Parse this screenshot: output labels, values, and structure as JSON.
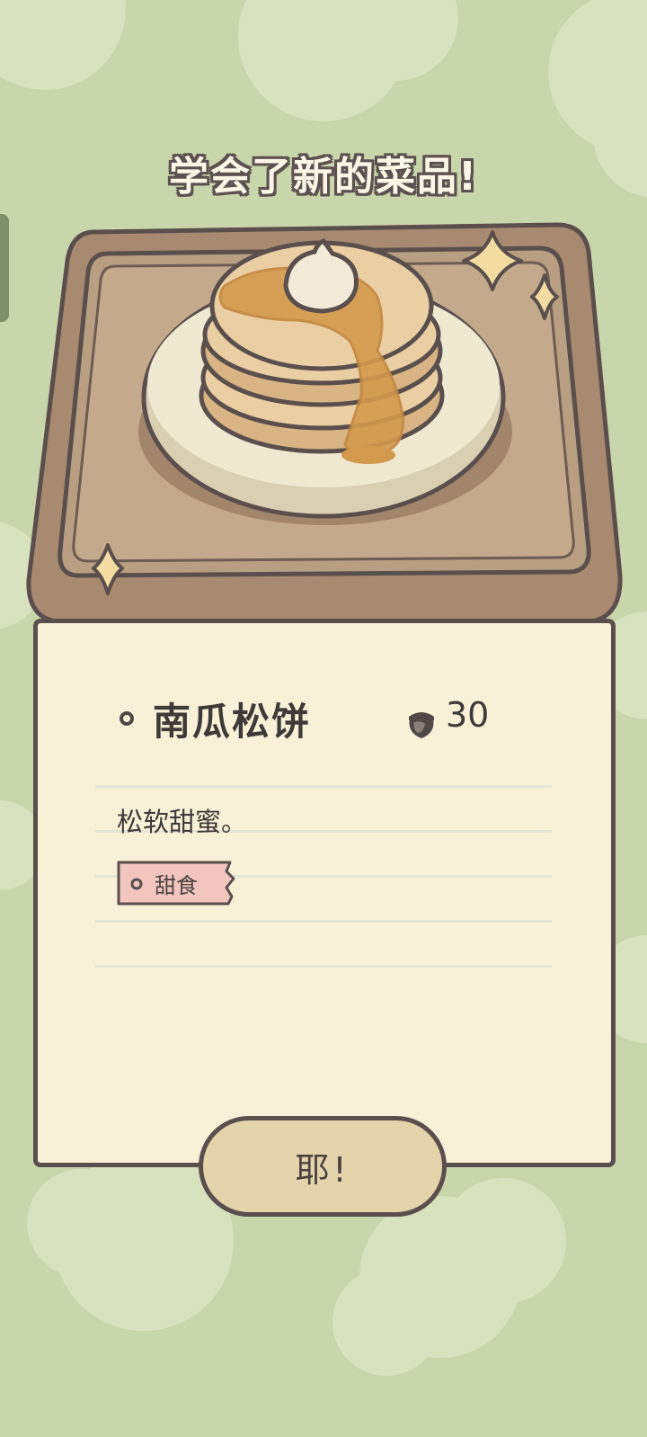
{
  "headline": "学会了新的菜品!",
  "dish": {
    "name": "南瓜松饼",
    "price": "30",
    "price_icon": "acorn-icon",
    "description": "松软甜蜜。",
    "tag": "甜食"
  },
  "confirm_label": "耶!",
  "colors": {
    "background": "#c9d5aa",
    "card": "#f8f1d8",
    "outline": "#5a4f4c",
    "tray": "#a88a70",
    "button": "#e3d4ac",
    "tag": "#f2c6bf"
  }
}
